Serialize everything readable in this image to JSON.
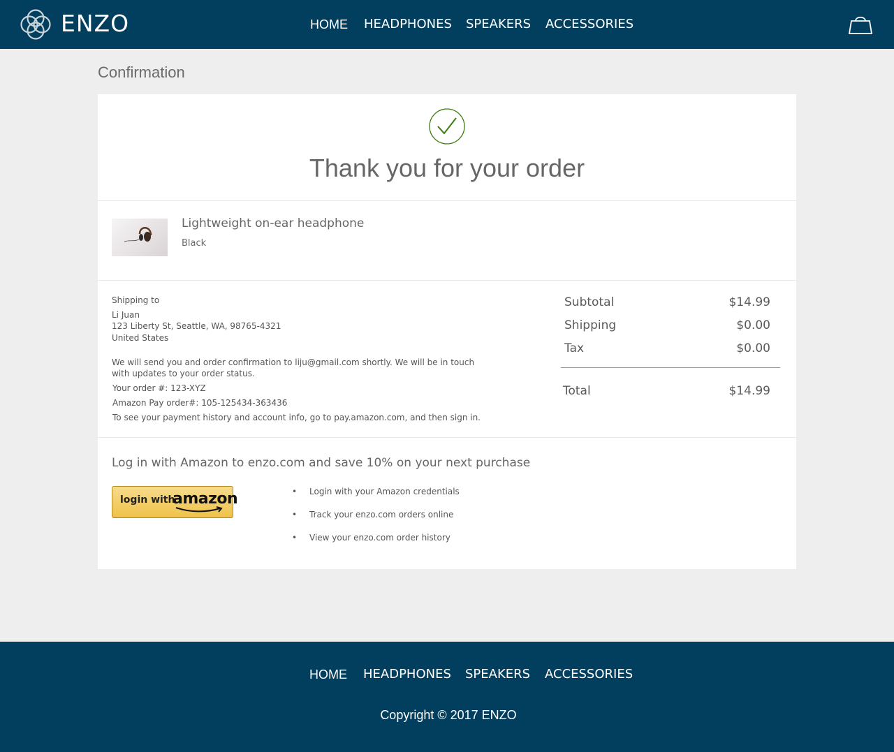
{
  "header": {
    "brand": "ENZO",
    "logo_icon": "interlocking-rings-logo",
    "cart_icon": "shopping-bag-icon",
    "nav": [
      "HOME",
      "HEADPHONES",
      "SPEAKERS",
      "ACCESSORIES"
    ]
  },
  "page": {
    "title": "Confirmation"
  },
  "confirmation": {
    "check_icon": "checkmark-circle-icon",
    "heading": "Thank you for your order",
    "check_color": "#3a7d0e"
  },
  "product": {
    "name": "Lightweight on-ear headphone",
    "color": "Black",
    "image_icon": "headphone-thumbnail"
  },
  "shipping": {
    "label": "Shipping to",
    "name": "Li Juan",
    "address": "123 Liberty St, Seattle, WA, 98765-4321",
    "country": "United States"
  },
  "notice": {
    "line1": "We will send you and order confirmation to liju@gmail.com shortly. We will be in touch",
    "line2": "with updates to your order status.",
    "order_number": "Your order #: 123-XYZ",
    "amazon_order": "Amazon Pay order#: 105-125434-363436",
    "history": "To see your payment history and account info, go to pay.amazon.com, and then sign in."
  },
  "summary": {
    "subtotal_label": "Subtotal",
    "subtotal": "$14.99",
    "shipping_label": "Shipping",
    "shipping": "$0.00",
    "tax_label": "Tax",
    "tax": "$0.00",
    "total_label": "Total",
    "total": "$14.99"
  },
  "promo": {
    "text": "Log in with Amazon to enzo.com and save 10% on your next purchase",
    "button_prefix": "login with",
    "button_brand": "amazon",
    "bullet_glyph": "•",
    "benefits": [
      "Login with your Amazon credentials",
      "Track your enzo.com orders online",
      "View your enzo.com order history"
    ]
  },
  "footer": {
    "nav": [
      "HOME",
      "HEADPHONES",
      "SPEAKERS",
      "ACCESSORIES"
    ],
    "copyright": "Copyright © 2017 ENZO"
  },
  "colors": {
    "header_bg": "#023f5f",
    "page_bg": "#eeeeee",
    "card_bg": "#ffffff",
    "button_gold": "#f0c14b"
  }
}
